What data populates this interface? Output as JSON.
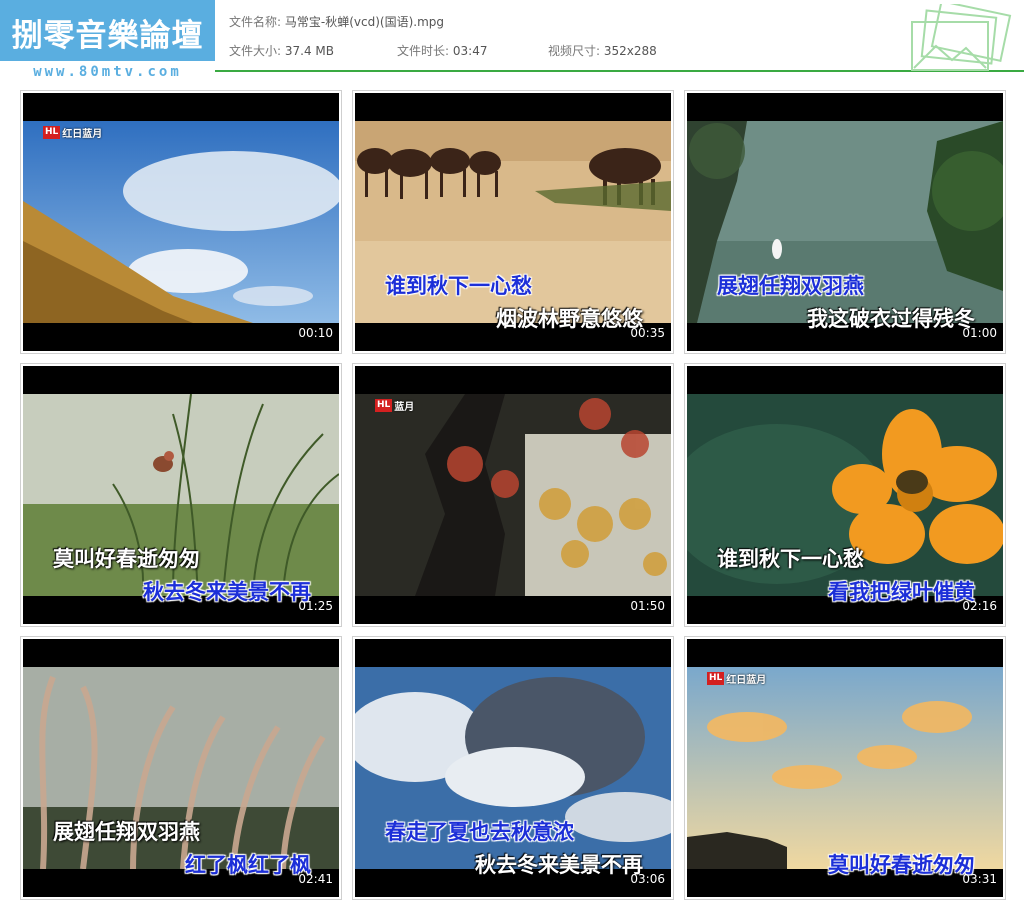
{
  "logo": {
    "title": "捌零音樂論壇",
    "url": "www.80mtv.com"
  },
  "info": {
    "filename_label": "文件名称:",
    "filename_value": "马常宝-秋蝉(vcd)(国语).mpg",
    "size_label": "文件大小:",
    "size_value": "37.4 MB",
    "duration_label": "文件时长:",
    "duration_value": "03:47",
    "dimension_label": "视频尺寸:",
    "dimension_value": "352x288"
  },
  "thumbnails": [
    {
      "time": "00:10",
      "lyric1": "",
      "lyric2": "",
      "logo_text": "红日蓝月",
      "logo_mark": "HL"
    },
    {
      "time": "00:35",
      "lyric1": "谁到秋下一心愁",
      "lyric2": "烟波林野意悠悠"
    },
    {
      "time": "01:00",
      "lyric1": "展翅任翔双羽燕",
      "lyric2": "我这破衣过得残冬"
    },
    {
      "time": "01:25",
      "lyric1": "莫叫好春逝匆匆",
      "lyric2": "秋去冬来美景不再"
    },
    {
      "time": "01:50",
      "lyric1": "",
      "lyric2": "",
      "logo_text": "蓝月",
      "logo_mark": "HL"
    },
    {
      "time": "02:16",
      "lyric1": "谁到秋下一心愁",
      "lyric2": "看我把绿叶催黄"
    },
    {
      "time": "02:41",
      "lyric1": "展翅任翔双羽燕",
      "lyric2": "红了枫红了枫"
    },
    {
      "time": "03:06",
      "lyric1": "春走了夏也去秋意浓",
      "lyric2": "秋去冬来美景不再"
    },
    {
      "time": "03:31",
      "lyric1": "",
      "lyric2": "莫叫好春逝匆匆",
      "logo_text": "红日蓝月",
      "logo_mark": "HL"
    }
  ]
}
